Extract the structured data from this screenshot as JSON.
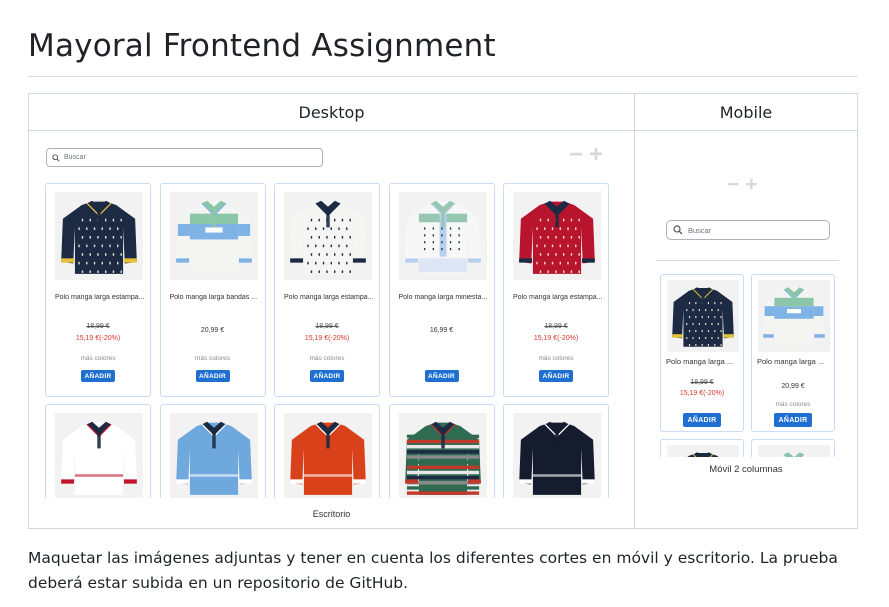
{
  "page": {
    "title": "Mayoral Frontend Assignment",
    "description": "Maquetar las imágenes adjuntas y tener en cuenta los diferentes cortes en móvil y escritorio. La prueba deberá estar subida en un repositorio de GitHub."
  },
  "table": {
    "headers": [
      "Desktop",
      "Mobile"
    ]
  },
  "desktop": {
    "search_placeholder": "Buscar",
    "zoom_minus": "−",
    "zoom_plus": "+",
    "caption": "Escritorio",
    "products": [
      {
        "name": "Polo manga larga estampa...",
        "old_price": "18,99 €",
        "price": "",
        "sale_price": "15,19 €(-20%)",
        "more": "más colores",
        "button": "AÑADIR",
        "shirt": "#1c2a44",
        "collar": "#1c2a44",
        "trim": "#e6c23a",
        "pattern": "dots"
      },
      {
        "name": "Polo manga larga bandas ...",
        "old_price": "",
        "price": "20,99 €",
        "sale_price": "",
        "more": "más colores",
        "button": "AÑADIR",
        "shirt": "#f4f4f2",
        "collar": "#8bc6a8",
        "trim": "#7fb3e6",
        "pattern": "bands"
      },
      {
        "name": "Polo manga larga estampa...",
        "old_price": "18,99 €",
        "price": "",
        "sale_price": "15,19 €(-20%)",
        "more": "más colores",
        "button": "AÑADIR",
        "shirt": "#f5f5f3",
        "collar": "#1c2a44",
        "trim": "#1c2a44",
        "pattern": "dots"
      },
      {
        "name": "Polo manga larga miniesta...",
        "old_price": "",
        "price": "16,99 €",
        "sale_price": "",
        "more": "",
        "button": "AÑADIR",
        "shirt": "#f7f7f7",
        "collar": "#96c7b3",
        "trim": "#b9cfee",
        "pattern": "set"
      },
      {
        "name": "Polo manga larga estampa...",
        "old_price": "18,99 €",
        "price": "",
        "sale_price": "15,19 €(-20%)",
        "more": "más colores",
        "button": "AÑADIR",
        "shirt": "#b8142e",
        "collar": "#1c2a44",
        "trim": "#1c2a44",
        "pattern": "dots"
      },
      {
        "name": "",
        "old_price": "",
        "price": "",
        "sale_price": "",
        "more": "",
        "button": "",
        "shirt": "#ffffff",
        "collar": "#1c2a44",
        "trim": "#c0172c",
        "pattern": "plain"
      },
      {
        "name": "",
        "old_price": "",
        "price": "",
        "sale_price": "",
        "more": "",
        "button": "",
        "shirt": "#6fa8dc",
        "collar": "#1c2a44",
        "trim": "#ffffff",
        "pattern": "plain"
      },
      {
        "name": "",
        "old_price": "",
        "price": "",
        "sale_price": "",
        "more": "",
        "button": "",
        "shirt": "#d8411a",
        "collar": "#1c2a44",
        "trim": "#ffffff",
        "pattern": "plain"
      },
      {
        "name": "",
        "old_price": "",
        "price": "",
        "sale_price": "",
        "more": "",
        "button": "",
        "shirt": "#2f6b52",
        "collar": "#1c2a44",
        "trim": "#c0392b",
        "pattern": "stripes"
      },
      {
        "name": "",
        "old_price": "",
        "price": "",
        "sale_price": "",
        "more": "",
        "button": "",
        "shirt": "#141c2e",
        "collar": "#141c2e",
        "trim": "#ffffff",
        "pattern": "plain"
      }
    ]
  },
  "mobile": {
    "search_placeholder": "Buscar",
    "zoom_minus": "−",
    "zoom_plus": "+",
    "caption": "Móvil 2 columnas",
    "products": [
      {
        "name": "Polo manga larga ...",
        "old_price": "18,99 €",
        "price": "",
        "sale_price": "15,19 €(-20%)",
        "more": "",
        "button": "AÑADIR",
        "shirt": "#1c2a44",
        "collar": "#1c2a44",
        "trim": "#e6c23a",
        "pattern": "dots"
      },
      {
        "name": "Polo manga larga ...",
        "old_price": "",
        "price": "20,99 €",
        "sale_price": "",
        "more": "más colores",
        "button": "AÑADIR",
        "shirt": "#f4f4f2",
        "collar": "#8bc6a8",
        "trim": "#7fb3e6",
        "pattern": "bands"
      },
      {
        "name": "",
        "old_price": "",
        "price": "",
        "sale_price": "",
        "more": "",
        "button": "",
        "shirt": "#1c2a44",
        "collar": "#1c2a44",
        "trim": "#e6c23a",
        "pattern": "plain"
      },
      {
        "name": "",
        "old_price": "",
        "price": "",
        "sale_price": "",
        "more": "",
        "button": "",
        "shirt": "#f4f4f2",
        "collar": "#8bc6a8",
        "trim": "#7fb3e6",
        "pattern": "plain"
      }
    ]
  }
}
